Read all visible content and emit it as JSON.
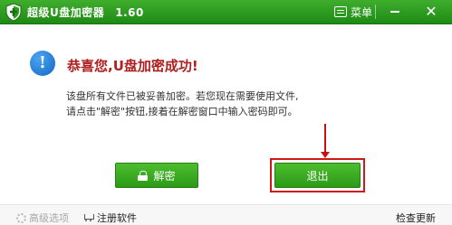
{
  "window": {
    "title": "超级U盘加密器",
    "version": "1.60",
    "menu_label": "菜单",
    "close_glyph": "✕"
  },
  "dialog": {
    "headline": "恭喜您,U盘加密成功!",
    "message": "该盘所有文件已被妥善加密。若您现在需要使用文件,\n请点击\"解密\"按钮,接着在解密窗口中输入密码即可。",
    "info_glyph": "!"
  },
  "buttons": {
    "decrypt_label": "解密",
    "exit_label": "退出"
  },
  "footer": {
    "advanced_label": "高级选项",
    "register_label": "注册软件",
    "update_label": "检查更新"
  },
  "colors": {
    "titlebar": "#2c9a1f",
    "button": "#3aaa24",
    "headline": "#b02020",
    "highlight": "#d01818"
  },
  "icons": [
    "shield-logo-icon",
    "menu-icon",
    "minimize-icon",
    "close-icon",
    "info-icon",
    "lock-icon",
    "gear-icon",
    "cart-icon"
  ]
}
